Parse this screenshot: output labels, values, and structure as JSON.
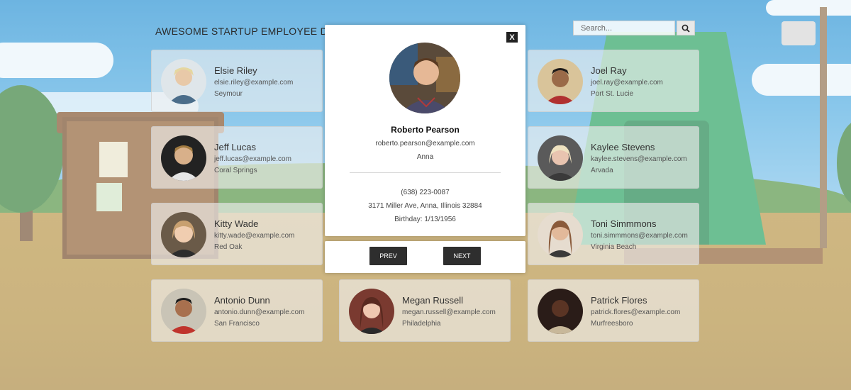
{
  "header": {
    "title": "AWESOME STARTUP EMPLOYEE DIREC",
    "search_placeholder": "Search...",
    "search_icon": "magnifier-icon"
  },
  "employees": [
    {
      "name": "Elsie Riley",
      "email": "elsie.riley@example.com",
      "city": "Seymour",
      "avatar_color": "#c9b48a"
    },
    {
      "name": "Joel Ray",
      "email": "joel.ray@example.com",
      "city": "Port St. Lucie",
      "avatar_color": "#8a5a3a"
    },
    {
      "name": "Jeff Lucas",
      "email": "jeff.lucas@example.com",
      "city": "Coral Springs",
      "avatar_color": "#b08a6a"
    },
    {
      "name": "Kaylee Stevens",
      "email": "kaylee.stevens@example.com",
      "city": "Arvada",
      "avatar_color": "#d8c8b8"
    },
    {
      "name": "Kitty Wade",
      "email": "kitty.wade@example.com",
      "city": "Red Oak",
      "avatar_color": "#c8a080"
    },
    {
      "name": "Toni Simmmons",
      "email": "toni.simmmons@example.com",
      "city": "Virginia Beach",
      "avatar_color": "#b88a70"
    },
    {
      "name": "Antonio Dunn",
      "email": "antonio.dunn@example.com",
      "city": "San Francisco",
      "avatar_color": "#a87050"
    },
    {
      "name": "Megan Russell",
      "email": "megan.russell@example.com",
      "city": "Philadelphia",
      "avatar_color": "#7a4a3a"
    },
    {
      "name": "Patrick Flores",
      "email": "patrick.flores@example.com",
      "city": "Murfreesboro",
      "avatar_color": "#3a2a22"
    }
  ],
  "modal": {
    "close_label": "X",
    "name": "Roberto Pearson",
    "email": "roberto.pearson@example.com",
    "city": "Anna",
    "phone": "(638) 223-0087",
    "address": "3171 Miller Ave, Anna, Illinois 32884",
    "birthday": "Birthday: 1/13/1956",
    "prev_label": "PREV",
    "next_label": "NEXT"
  }
}
